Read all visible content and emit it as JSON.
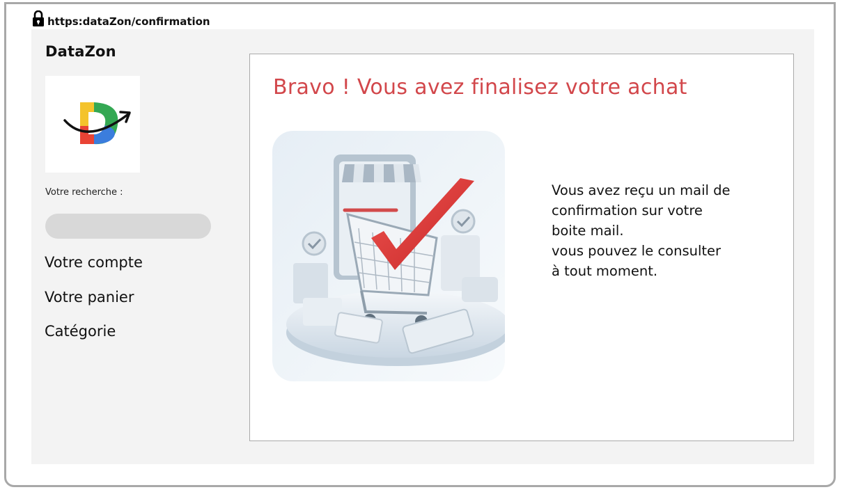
{
  "browser": {
    "url": "https:dataZon/confirmation"
  },
  "sidebar": {
    "brand": "DataZon",
    "search_label": "Votre recherche :",
    "search_value": "",
    "nav": [
      {
        "label": "Votre compte"
      },
      {
        "label": "Votre panier"
      },
      {
        "label": "Catégorie"
      }
    ]
  },
  "main": {
    "title": "Bravo ! Vous avez finalisez votre achat",
    "message": "Vous avez reçu un mail de\nconfirmation sur votre\nboite mail.\nvous pouvez le consulter\nà tout moment."
  },
  "colors": {
    "title": "#d2474b",
    "page_background": "#f3f3f3",
    "checkmark": "#e03a3a"
  },
  "icons": {
    "address_bar": "lock-icon",
    "logo": "datazon-logo",
    "illustration": "shopping-cart-checkmark-illustration"
  }
}
